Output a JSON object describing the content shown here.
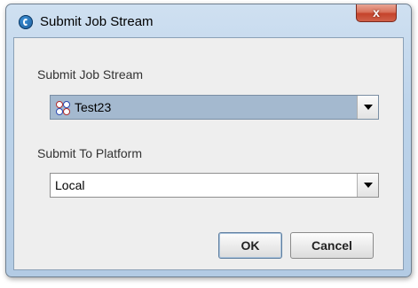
{
  "window": {
    "title": "Submit Job Stream",
    "close_label": "x"
  },
  "form": {
    "job_stream": {
      "label": "Submit Job Stream",
      "value": "Test23",
      "icon": "job-stream-icon"
    },
    "platform": {
      "label": "Submit To Platform",
      "value": "Local"
    }
  },
  "buttons": {
    "ok_label": "OK",
    "cancel_label": "Cancel"
  },
  "colors": {
    "selected_combo": "#a4b9cf",
    "close_button": "#c4432b",
    "window_frame": "#bcd3ea"
  }
}
